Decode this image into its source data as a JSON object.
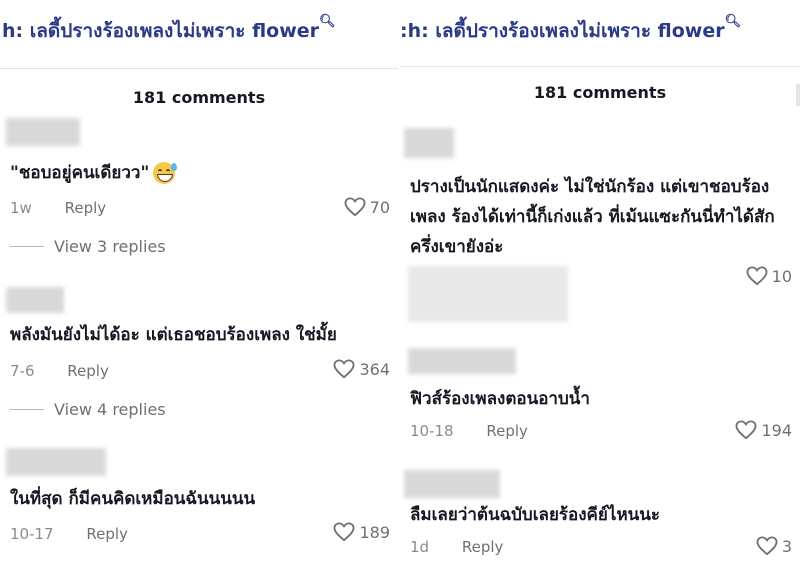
{
  "left": {
    "search_prefix": "h:",
    "search_query": "เลดี้ปรางร้องเพลงไม่เพราะ flower",
    "comment_count": "181 comments",
    "comments": [
      {
        "text": "\"ชอบอยู่คนเดียวว\"",
        "time": "1w",
        "reply": "Reply",
        "likes": "70",
        "view_replies": "View 3 replies"
      },
      {
        "text": "พลังมันยังไม่ได้อะ แต่เธอชอบร้องเพลง ใช่มั้ย",
        "time": "7-6",
        "reply": "Reply",
        "likes": "364",
        "view_replies": "View 4 replies"
      },
      {
        "text": "ในที่สุด ก็มีคนคิดเหมือนฉันนนนน",
        "time": "10-17",
        "reply": "Reply",
        "likes": "189"
      }
    ]
  },
  "right": {
    "search_prefix": ":h:",
    "search_query": "เลดี้ปรางร้องเพลงไม่เพราะ flower",
    "comment_count": "181 comments",
    "comments": [
      {
        "text": "ปรางเป็นนักแสดงค่ะ ไม่ใช่นักร้อง แต่เขาชอบร้อง เพลง ร้องได้เท่านี้ก็เก่งแล้ว ที่เม้นแซะกันนี่ทำได้สัก ครึ่งเขายังอ่ะ",
        "likes": "10"
      },
      {
        "text": "ฟิวส์ร้องเพลงตอนอาบน้ำ",
        "time": "10-18",
        "reply": "Reply",
        "likes": "194"
      },
      {
        "text": "ลืมเลยว่าต้นฉบับเลยร้องคีย์ไหนนะ",
        "time": "1d",
        "reply": "Reply",
        "likes": "3"
      }
    ]
  },
  "icons": {
    "search": "search-icon",
    "like": "heart-outline-icon",
    "emoji": "grinning-sweat-emoji"
  },
  "colors": {
    "search_text": "#2b3a87",
    "meta": "#8a8b91",
    "text": "#161823"
  }
}
